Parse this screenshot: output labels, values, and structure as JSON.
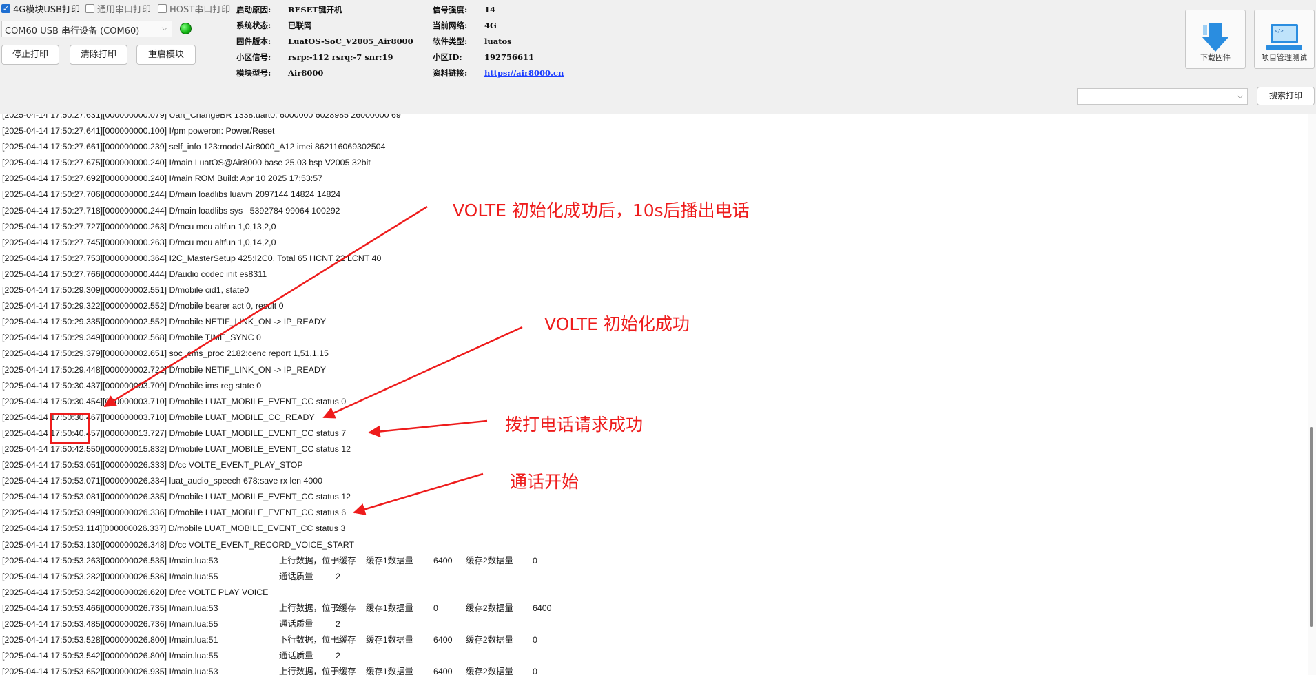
{
  "top": {
    "checkboxes": [
      {
        "label": "4G模块USB打印",
        "checked": true
      },
      {
        "label": "通用串口打印",
        "checked": false
      },
      {
        "label": "HOST串口打印",
        "checked": false
      }
    ],
    "port_value": "COM60 USB 串行设备 (COM60)",
    "buttons": {
      "stop": "停止打印",
      "clear": "清除打印",
      "restart": "重启模块"
    },
    "info_left": [
      {
        "label": "启动原因:",
        "value": "RESET键开机"
      },
      {
        "label": "系统状态:",
        "value": "已联网"
      },
      {
        "label": "固件版本:",
        "value": "LuatOS-SoC_V2005_Air8000"
      },
      {
        "label": "小区信号:",
        "value": "rsrp:-112 rsrq:-7 snr:19"
      },
      {
        "label": "模块型号:",
        "value": "Air8000"
      }
    ],
    "info_right": [
      {
        "label": "信号强度:",
        "value": "14"
      },
      {
        "label": "当前网络:",
        "value": "4G"
      },
      {
        "label": "软件类型:",
        "value": "luatos"
      },
      {
        "label": "小区ID:",
        "value": "192756611"
      },
      {
        "label": "资料链接:",
        "value": "https://air8000.cn"
      }
    ],
    "download_label": "下载固件",
    "project_label": "项目管理测试",
    "search_label": "搜索打印",
    "colors": {
      "accent": "#1f6fd1",
      "led": "#12b312",
      "annotation": "#ee1c1c"
    }
  },
  "log_lines": [
    "[2025-04-14 17:50:27.631][000000000.079] Uart_ChangeBR 1338:uart0, 6000000 6028985 26000000 69",
    "[2025-04-14 17:50:27.641][000000000.100] I/pm poweron: Power/Reset",
    "[2025-04-14 17:50:27.661][000000000.239] self_info 123:model Air8000_A12 imei 862116069302504",
    "[2025-04-14 17:50:27.675][000000000.240] I/main LuatOS@Air8000 base 25.03 bsp V2005 32bit",
    "[2025-04-14 17:50:27.692][000000000.240] I/main ROM Build: Apr 10 2025 17:53:57",
    "[2025-04-14 17:50:27.706][000000000.244] D/main loadlibs luavm 2097144 14824 14824",
    "[2025-04-14 17:50:27.718][000000000.244] D/main loadlibs sys   5392784 99064 100292",
    "[2025-04-14 17:50:27.727][000000000.263] D/mcu mcu altfun 1,0,13,2,0",
    "[2025-04-14 17:50:27.745][000000000.263] D/mcu mcu altfun 1,0,14,2,0",
    "[2025-04-14 17:50:27.753][000000000.364] I2C_MasterSetup 425:I2C0, Total 65 HCNT 22 LCNT 40",
    "[2025-04-14 17:50:27.766][000000000.444] D/audio codec init es8311",
    "[2025-04-14 17:50:29.309][000000002.551] D/mobile cid1, state0",
    "[2025-04-14 17:50:29.322][000000002.552] D/mobile bearer act 0, result 0",
    "[2025-04-14 17:50:29.335][000000002.552] D/mobile NETIF_LINK_ON -> IP_READY",
    "[2025-04-14 17:50:29.349][000000002.568] D/mobile TIME_SYNC 0",
    "[2025-04-14 17:50:29.379][000000002.651] soc_cms_proc 2182:cenc report 1,51,1,15",
    "[2025-04-14 17:50:29.448][000000002.722] D/mobile NETIF_LINK_ON -> IP_READY",
    "[2025-04-14 17:50:30.437][000000003.709] D/mobile ims reg state 0",
    "[2025-04-14 17:50:30.454][000000003.710] D/mobile LUAT_MOBILE_EVENT_CC status 0",
    "[2025-04-14 17:50:30.467][000000003.710] D/mobile LUAT_MOBILE_CC_READY",
    "[2025-04-14 17:50:40.457][000000013.727] D/mobile LUAT_MOBILE_EVENT_CC status 7",
    "[2025-04-14 17:50:42.550][000000015.832] D/mobile LUAT_MOBILE_EVENT_CC status 12",
    "[2025-04-14 17:50:53.051][000000026.333] D/cc VOLTE_EVENT_PLAY_STOP",
    "[2025-04-14 17:50:53.071][000000026.334] luat_audio_speech 678:save rx len 4000",
    "[2025-04-14 17:50:53.081][000000026.335] D/mobile LUAT_MOBILE_EVENT_CC status 12",
    "[2025-04-14 17:50:53.099][000000026.336] D/mobile LUAT_MOBILE_EVENT_CC status 6",
    "[2025-04-14 17:50:53.114][000000026.337] D/mobile LUAT_MOBILE_EVENT_CC status 3",
    "[2025-04-14 17:50:53.130][000000026.348] D/cc VOLTE_EVENT_RECORD_VOICE_START",
    [
      "[2025-04-14 17:50:53.263][000000026.535] I/main.lua:53",
      "上行数据，位于缓存",
      "1",
      "缓存1数据量",
      "6400",
      "缓存2数据量",
      "0"
    ],
    [
      "[2025-04-14 17:50:53.282][000000026.536] I/main.lua:55",
      "通话质量",
      "2"
    ],
    "[2025-04-14 17:50:53.342][000000026.620] D/cc VOLTE PLAY VOICE",
    [
      "[2025-04-14 17:50:53.466][000000026.735] I/main.lua:53",
      "上行数据，位于缓存",
      "2",
      "缓存1数据量",
      "0",
      "缓存2数据量",
      "6400"
    ],
    [
      "[2025-04-14 17:50:53.485][000000026.736] I/main.lua:55",
      "通话质量",
      "2"
    ],
    [
      "[2025-04-14 17:50:53.528][000000026.800] I/main.lua:51",
      "下行数据，位于缓存",
      "1",
      "缓存1数据量",
      "6400",
      "缓存2数据量",
      "0"
    ],
    [
      "[2025-04-14 17:50:53.542][000000026.800] I/main.lua:55",
      "通话质量",
      "2"
    ],
    [
      "[2025-04-14 17:50:53.652][000000026.935] I/main.lua:53",
      "上行数据，位于缓存",
      "1",
      "缓存1数据量",
      "6400",
      "缓存2数据量",
      "0"
    ]
  ],
  "annotations": [
    {
      "text": "VOLTE 初始化成功后，10s后播出电话"
    },
    {
      "text": "VOLTE 初始化成功"
    },
    {
      "text": "拨打电话请求成功"
    },
    {
      "text": "通话开始"
    }
  ]
}
